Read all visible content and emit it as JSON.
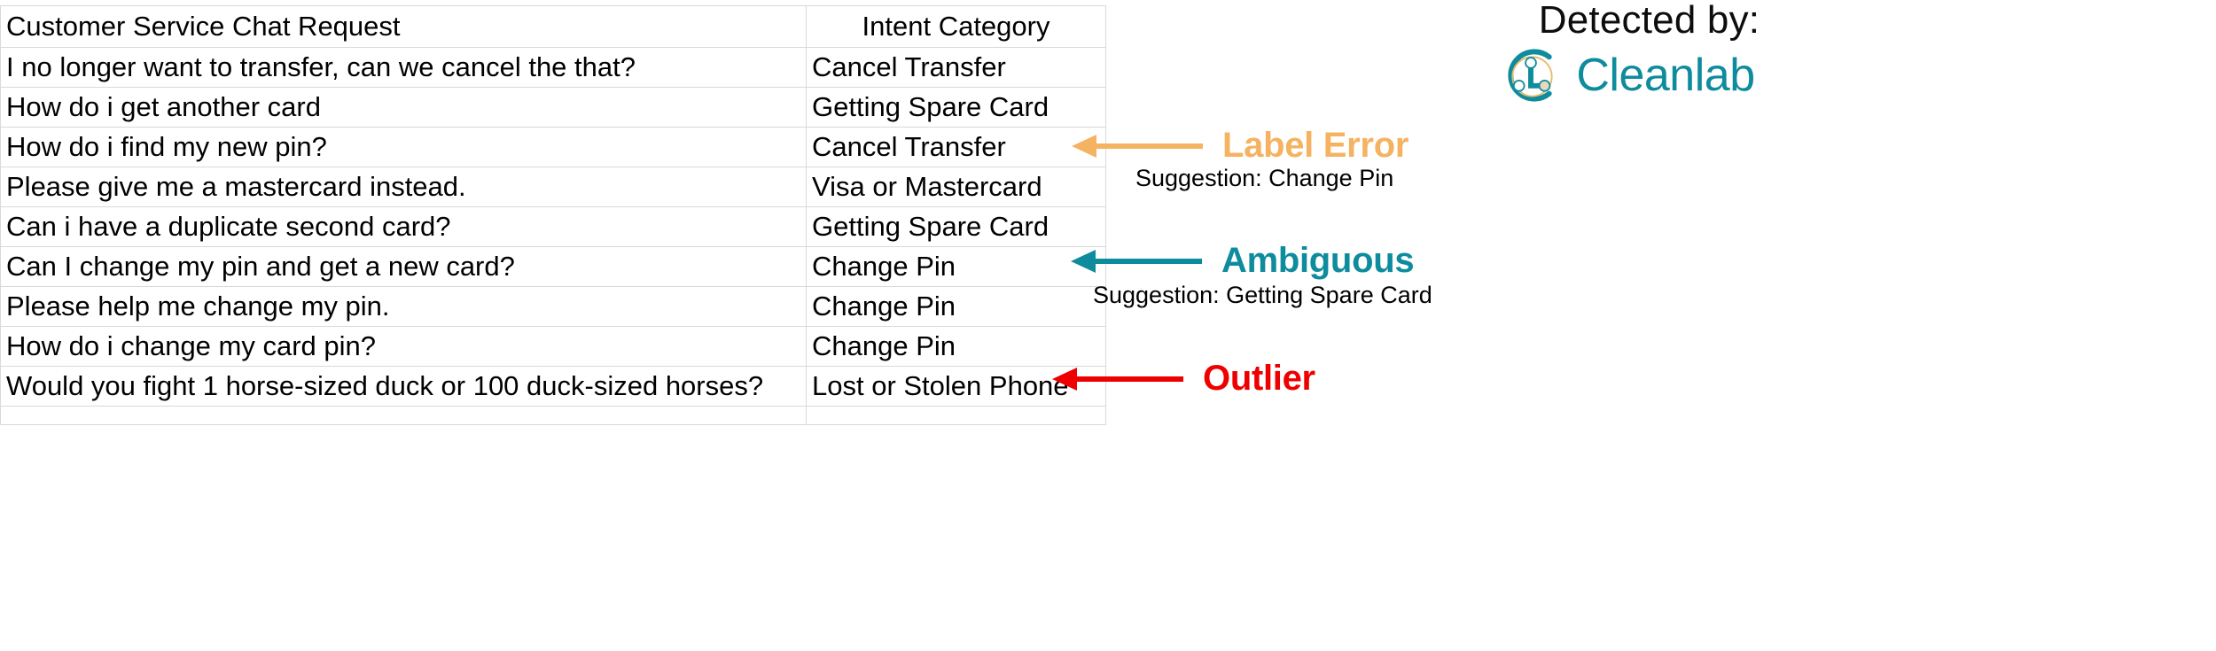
{
  "table": {
    "columns": [
      "Customer Service Chat Request",
      "Intent Category"
    ],
    "rows": [
      {
        "request": "I no longer want to transfer, can we cancel the that?",
        "intent": "Cancel Transfer"
      },
      {
        "request": "How do i get another card",
        "intent": "Getting Spare Card"
      },
      {
        "request": "How do i find my new pin?",
        "intent": "Cancel Transfer"
      },
      {
        "request": "Please give me a mastercard instead.",
        "intent": "Visa or Mastercard"
      },
      {
        "request": "Can i have a duplicate second card?",
        "intent": "Getting Spare Card"
      },
      {
        "request": "Can I change my pin and get a new card?",
        "intent": "Change Pin"
      },
      {
        "request": "Please help me change my pin.",
        "intent": "Change Pin"
      },
      {
        "request": "How do i change my card pin?",
        "intent": "Change Pin"
      },
      {
        "request": "Would you fight 1 horse-sized duck or 100 duck-sized horses?",
        "intent": "Lost or Stolen Phone"
      }
    ]
  },
  "panel": {
    "detected_by": "Detected by:",
    "brand_name": "Cleanlab",
    "brand_color": "#0e8c9e",
    "brand_accent_color": "#e8b96a",
    "annotations": [
      {
        "label": "Label Error",
        "color": "#f5b362",
        "suggestion": "Suggestion: Change Pin"
      },
      {
        "label": "Ambiguous",
        "color": "#0e8c9e",
        "suggestion": "Suggestion: Getting Spare Card"
      },
      {
        "label": "Outlier",
        "color": "#ee0000",
        "suggestion": ""
      }
    ]
  }
}
